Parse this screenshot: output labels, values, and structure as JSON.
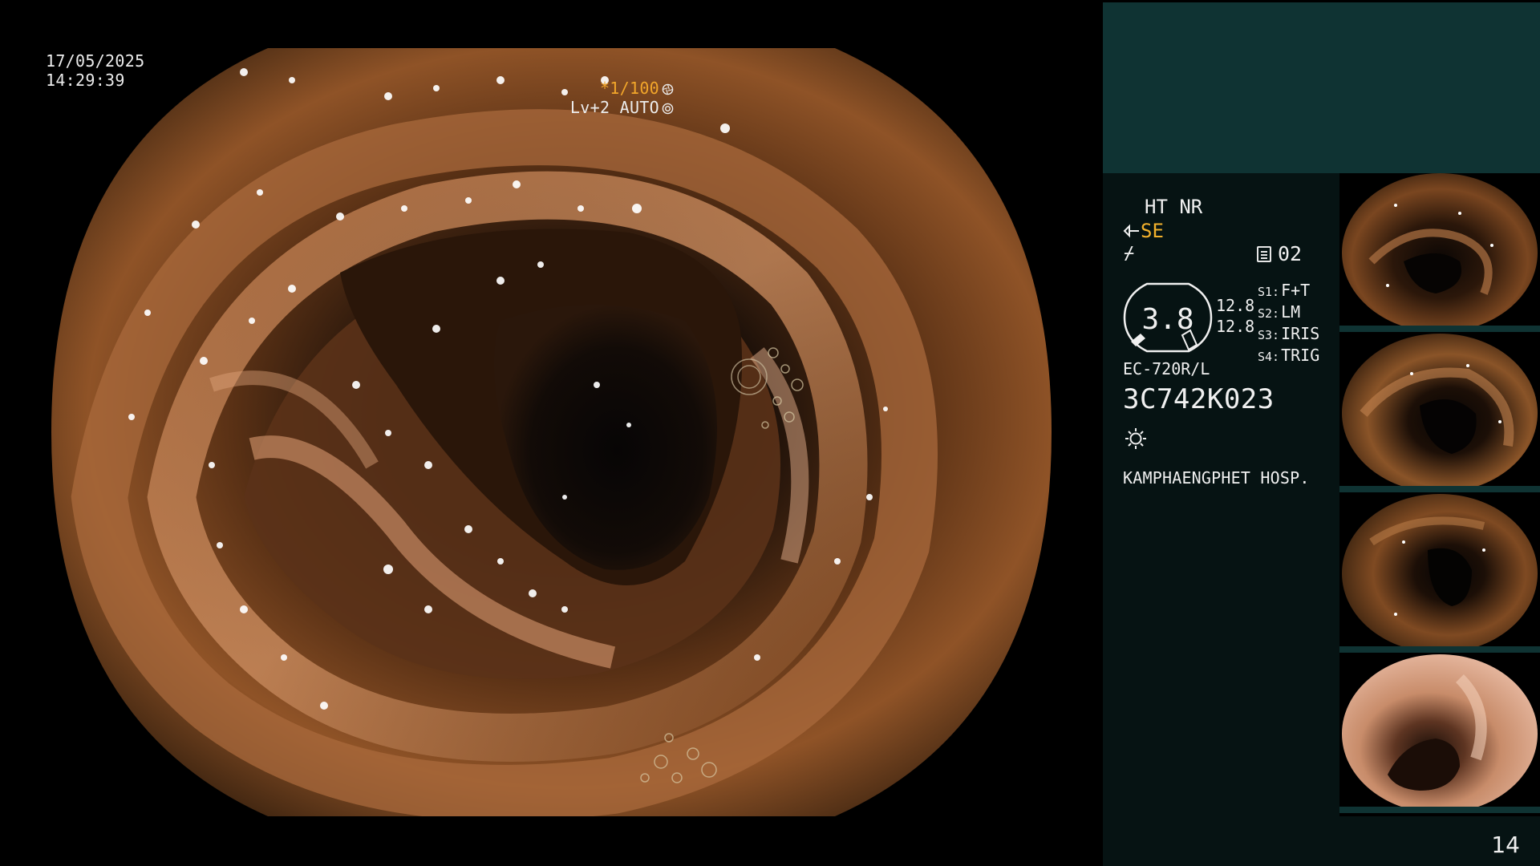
{
  "overlay": {
    "date": "17/05/2025",
    "time": "14:29:39",
    "shutter": "*1/100",
    "level": "Lv+2 AUTO"
  },
  "panel": {
    "ht_nr": "HT NR",
    "se": "SE",
    "memo_count": "02",
    "gauge_value": "3.8",
    "gauge_num_top": "12.8",
    "gauge_num_bottom": "12.8",
    "switches": [
      {
        "key": "S1:",
        "value": "F+T"
      },
      {
        "key": "S2:",
        "value": "LM"
      },
      {
        "key": "S3:",
        "value": "IRIS"
      },
      {
        "key": "S4:",
        "value": "TRIG"
      }
    ],
    "scope_model": "EC-720R/L",
    "scope_serial": "3C742K023",
    "hospital": "KAMPHAENGPHET HOSP."
  },
  "thumbnails": [
    {
      "label": "thumbnail-1",
      "tone": "dark-brown"
    },
    {
      "label": "thumbnail-2",
      "tone": "dark-brown"
    },
    {
      "label": "thumbnail-3",
      "tone": "dark-brown"
    },
    {
      "label": "thumbnail-4",
      "tone": "pink"
    }
  ],
  "icons": {
    "shutter": "shutter-icon",
    "iris": "iris-icon",
    "scope_angle": "scope-angle-icon",
    "freeze": "freeze-icon",
    "memo": "memo-icon",
    "light": "light-icon"
  },
  "colors": {
    "accent": "#f2a62a",
    "panel_top": "#0f3333",
    "panel_body": "#061313"
  },
  "page_number": "14"
}
